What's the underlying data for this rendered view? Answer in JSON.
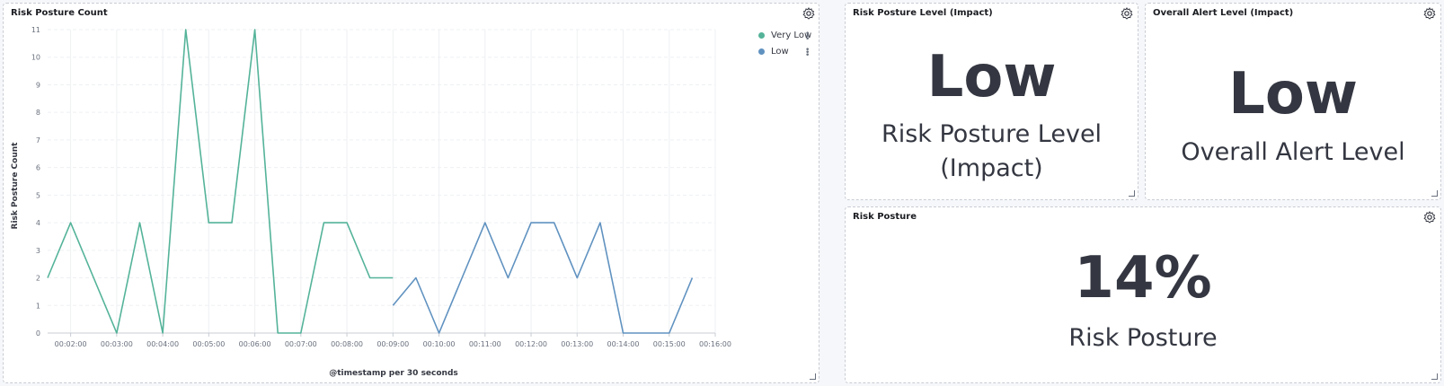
{
  "panels": {
    "risk_count": {
      "title": "Risk Posture Count"
    },
    "risk_level": {
      "title": "Risk Posture Level (Impact)",
      "value": "Low",
      "label_line1": "Risk Posture Level",
      "label_line2": "(Impact)"
    },
    "alert_level": {
      "title": "Overall Alert Level (Impact)",
      "value": "Low",
      "label": "Overall Alert Level"
    },
    "risk_posture": {
      "title": "Risk Posture",
      "value": "14%",
      "label": "Risk Posture"
    }
  },
  "icons": {
    "settings": "gear-icon",
    "resize": "resize-handle-icon",
    "legend_menu": "more-options-icon"
  },
  "chart_data": {
    "type": "line",
    "title": "",
    "xlabel": "@timestamp per 30 seconds",
    "ylabel": "Risk Posture Count",
    "ylim": [
      0,
      11
    ],
    "yticks": [
      0,
      1,
      2,
      3,
      4,
      5,
      6,
      7,
      8,
      9,
      10,
      11
    ],
    "xticks": [
      "00:02:00",
      "00:03:00",
      "00:04:00",
      "00:05:00",
      "00:06:00",
      "00:07:00",
      "00:08:00",
      "00:09:00",
      "00:10:00",
      "00:11:00",
      "00:12:00",
      "00:13:00",
      "00:14:00",
      "00:15:00",
      "00:16:00"
    ],
    "grid": true,
    "legend_position": "top-right",
    "series": [
      {
        "name": "Very Low",
        "color": "#54b399",
        "x": [
          "00:01:30",
          "00:02:00",
          "00:02:30",
          "00:03:00",
          "00:03:30",
          "00:04:00",
          "00:04:30",
          "00:05:00",
          "00:05:30",
          "00:06:00",
          "00:06:30",
          "00:07:00",
          "00:07:30",
          "00:08:00",
          "00:08:30",
          "00:09:00"
        ],
        "y": [
          2,
          4,
          2,
          0,
          4,
          0,
          11,
          4,
          4,
          11,
          0,
          0,
          4,
          4,
          2,
          2
        ]
      },
      {
        "name": "Low",
        "color": "#6092c0",
        "x": [
          "00:09:00",
          "00:09:30",
          "00:10:00",
          "00:10:30",
          "00:11:00",
          "00:11:30",
          "00:12:00",
          "00:12:30",
          "00:13:00",
          "00:13:30",
          "00:14:00",
          "00:14:30",
          "00:15:00",
          "00:15:30"
        ],
        "y": [
          1,
          2,
          0,
          2,
          4,
          2,
          4,
          4,
          2,
          4,
          0,
          0,
          0,
          2
        ]
      }
    ]
  }
}
